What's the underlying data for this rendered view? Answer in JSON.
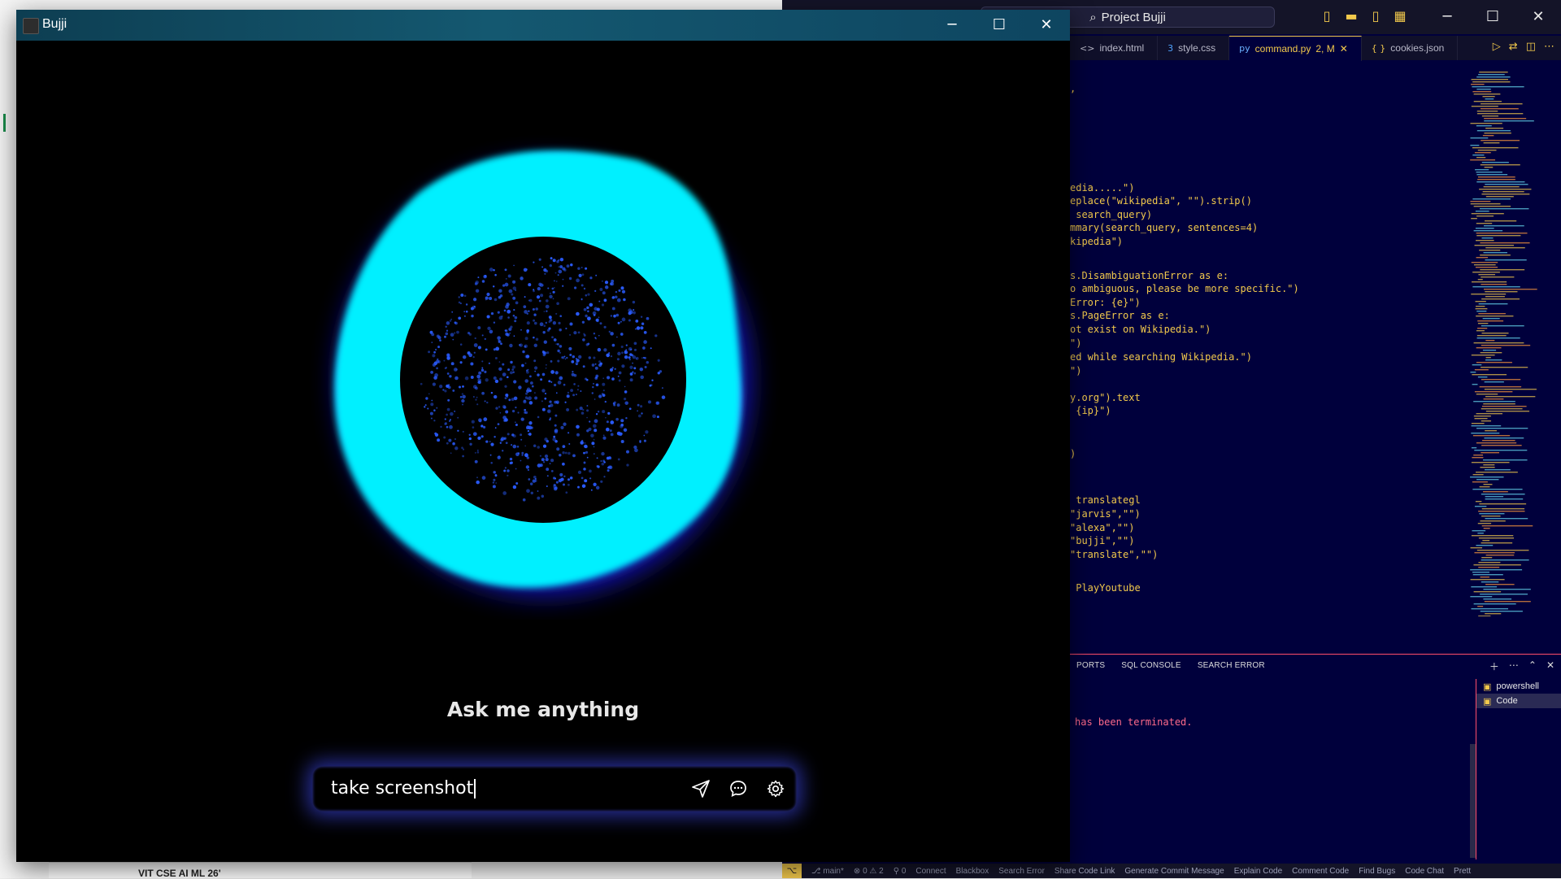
{
  "bujji_window": {
    "title": "Bujji",
    "minimize_icon": "minimize-icon",
    "maximize_icon": "maximize-icon",
    "close_icon": "close-icon",
    "prompt_heading": "Ask me anything",
    "input_value": "take screenshot",
    "send_icon": "send-icon",
    "chat_icon": "chat-icon",
    "settings_icon": "gear-icon",
    "orb_colors": {
      "outer_glow": "#1a1aff",
      "ring_cyan": "#00f0ff",
      "ring_purple": "#7b2cff",
      "core": "#000000",
      "particles": "#2a5cff"
    }
  },
  "vscode": {
    "search_text": "Project Bujji",
    "tabs": [
      {
        "label": "index.html",
        "icon": "<>"
      },
      {
        "label": "style.css",
        "icon": "3"
      },
      {
        "label": "command.py",
        "badge": "2, M",
        "icon": "py",
        "active": true
      },
      {
        "label": "cookies.json",
        "icon": "{ }"
      }
    ],
    "code_lines": [
      ",",
      "edia.....\")",
      "eplace(\"wikipedia\", \"\").strip()",
      " search_query)",
      "mmary(search_query, sentences=4)",
      "kipedia\")",
      "s.DisambiguationError as e:",
      "o ambiguous, please be more specific.\")",
      "Error: {e}\")",
      "s.PageError as e:",
      "ot exist on Wikipedia.\")",
      "\")",
      "ed while searching Wikipedia.\")",
      "\")",
      "y.org\").text",
      " {ip}\")",
      ")",
      " translategl",
      "\"jarvis\",\"\")",
      "\"alexa\",\"\")",
      "\"bujji\",\"\")",
      "\"translate\",\"\")",
      " PlayYoutube"
    ],
    "panel_tabs": [
      "PORTS",
      "SQL CONSOLE",
      "SEARCH ERROR"
    ],
    "terminal_message": "has been terminated.",
    "terminals": [
      {
        "label": "powershell"
      },
      {
        "label": "Code",
        "active": true
      }
    ],
    "status_items": [
      "main*",
      "0",
      "2",
      "0",
      "Connect",
      "Blackbox",
      "Search Error",
      "Share Code Link",
      "Generate Commit Message",
      "Explain Code",
      "Comment Code",
      "Find Bugs",
      "Code Chat",
      "Prett"
    ]
  },
  "background": {
    "bottom_text": "VIT CSE AI ML 26'"
  }
}
